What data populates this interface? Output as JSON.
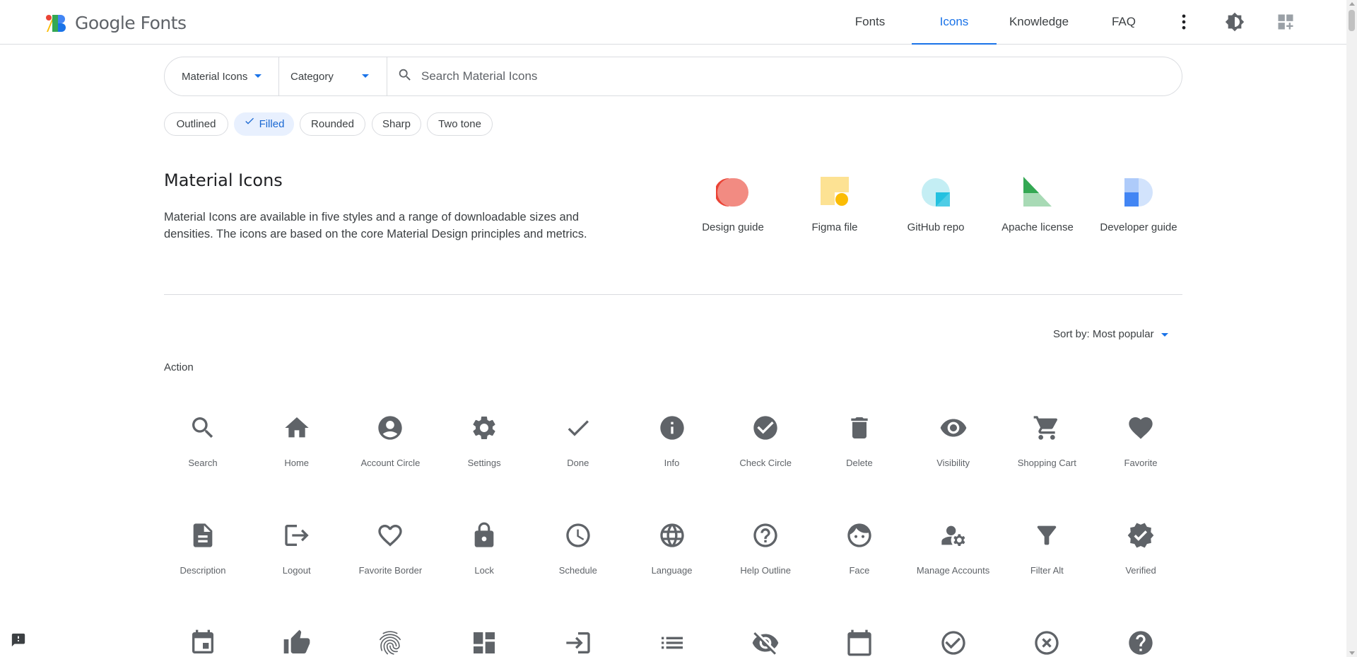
{
  "header": {
    "brand": "Google Fonts",
    "nav": [
      {
        "label": "Fonts"
      },
      {
        "label": "Icons",
        "active": true
      },
      {
        "label": "Knowledge"
      },
      {
        "label": "FAQ"
      }
    ],
    "icons": [
      "more-vert-icon",
      "brightness-icon",
      "dashboard-customize-icon"
    ]
  },
  "search": {
    "set_select": "Material Icons",
    "category_select": "Category",
    "placeholder": "Search Material Icons"
  },
  "styles": [
    {
      "label": "Outlined",
      "selected": false
    },
    {
      "label": "Filled",
      "selected": true
    },
    {
      "label": "Rounded",
      "selected": false
    },
    {
      "label": "Sharp",
      "selected": false
    },
    {
      "label": "Two tone",
      "selected": false
    }
  ],
  "intro": {
    "title": "Material Icons",
    "description": "Material Icons are available in five styles and a range of downloadable sizes and densities. The icons are based on the core Material Design principles and metrics."
  },
  "resources": [
    {
      "label": "Design guide"
    },
    {
      "label": "Figma file"
    },
    {
      "label": "GitHub repo"
    },
    {
      "label": "Apache license"
    },
    {
      "label": "Developer guide"
    }
  ],
  "sort": {
    "label": "Sort by: Most popular"
  },
  "section": {
    "label": "Action"
  },
  "icons": [
    {
      "label": "Search",
      "icon": "search-icon"
    },
    {
      "label": "Home",
      "icon": "home-icon"
    },
    {
      "label": "Account Circle",
      "icon": "account-circle-icon"
    },
    {
      "label": "Settings",
      "icon": "settings-icon"
    },
    {
      "label": "Done",
      "icon": "done-icon"
    },
    {
      "label": "Info",
      "icon": "info-icon"
    },
    {
      "label": "Check Circle",
      "icon": "check-circle-icon"
    },
    {
      "label": "Delete",
      "icon": "delete-icon"
    },
    {
      "label": "Visibility",
      "icon": "visibility-icon"
    },
    {
      "label": "Shopping Cart",
      "icon": "shopping-cart-icon"
    },
    {
      "label": "Favorite",
      "icon": "favorite-icon"
    },
    {
      "label": "Description",
      "icon": "description-icon"
    },
    {
      "label": "Logout",
      "icon": "logout-icon"
    },
    {
      "label": "Favorite Border",
      "icon": "favorite-border-icon"
    },
    {
      "label": "Lock",
      "icon": "lock-icon"
    },
    {
      "label": "Schedule",
      "icon": "schedule-icon"
    },
    {
      "label": "Language",
      "icon": "language-icon"
    },
    {
      "label": "Help Outline",
      "icon": "help-outline-icon"
    },
    {
      "label": "Face",
      "icon": "face-icon"
    },
    {
      "label": "Manage Accounts",
      "icon": "manage-accounts-icon"
    },
    {
      "label": "Filter Alt",
      "icon": "filter-alt-icon"
    },
    {
      "label": "Verified",
      "icon": "verified-icon"
    },
    {
      "label": "",
      "icon": "event-icon"
    },
    {
      "label": "",
      "icon": "thumb-up-icon"
    },
    {
      "label": "",
      "icon": "fingerprint-icon"
    },
    {
      "label": "",
      "icon": "dashboard-icon"
    },
    {
      "label": "",
      "icon": "login-icon"
    },
    {
      "label": "",
      "icon": "list-icon"
    },
    {
      "label": "",
      "icon": "visibility-off-icon"
    },
    {
      "label": "",
      "icon": "calendar-today-icon"
    },
    {
      "label": "",
      "icon": "check-circle-outline-icon"
    },
    {
      "label": "",
      "icon": "highlight-off-icon"
    },
    {
      "label": "",
      "icon": "help-icon"
    }
  ],
  "colors": {
    "accent": "#1a73e8",
    "icon": "#5f6368",
    "chip_selected_bg": "#e8f0fe"
  }
}
